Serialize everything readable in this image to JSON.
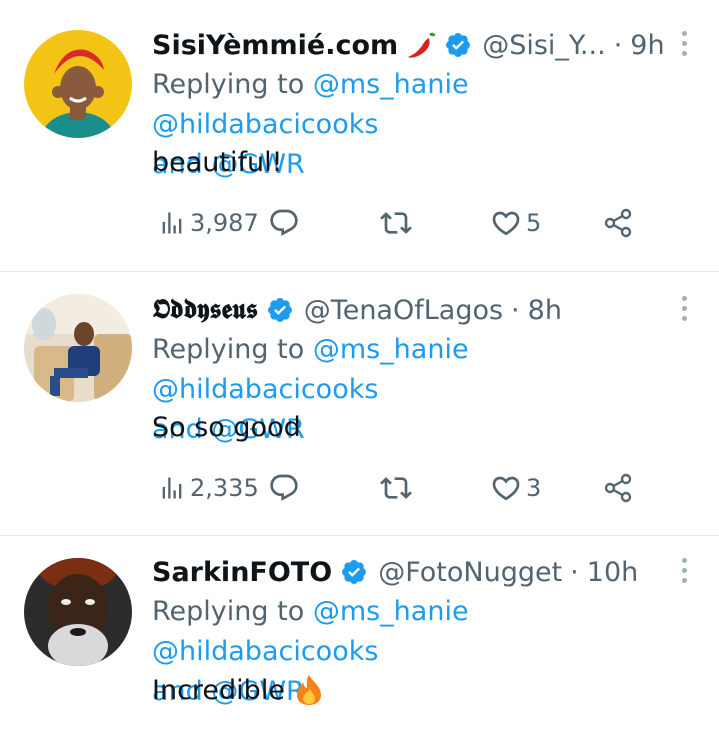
{
  "replying_prefix": "Replying to",
  "mentions": [
    "@ms_hanie",
    "@hildabacicooks"
  ],
  "and_word": "and",
  "mention_last": "@GWR",
  "tweets": [
    {
      "name": "SisiYèmmié.com",
      "name_emoji": "chili-pepper",
      "handle": "@Sisi_Y...",
      "time": "9h",
      "text": "beautiful!",
      "views": "3,987",
      "replies": "",
      "retweets": "",
      "likes": "5"
    },
    {
      "name": "𝕺𝖉𝖉𝖞𝖘𝖊𝖚𝖘",
      "handle": "@TenaOfLagos",
      "time": "8h",
      "text": "So so good",
      "views": "2,335",
      "replies": "",
      "retweets": "",
      "likes": "3"
    },
    {
      "name": "SarkinFOTO",
      "handle": "@FotoNugget",
      "time": "10h",
      "text": "Incredible",
      "text_emoji": "fire"
    }
  ],
  "colors": {
    "link": "#1d9bf0",
    "secondary": "#536471",
    "divider": "#e6ecf0",
    "verified": "#1d9bf0"
  }
}
